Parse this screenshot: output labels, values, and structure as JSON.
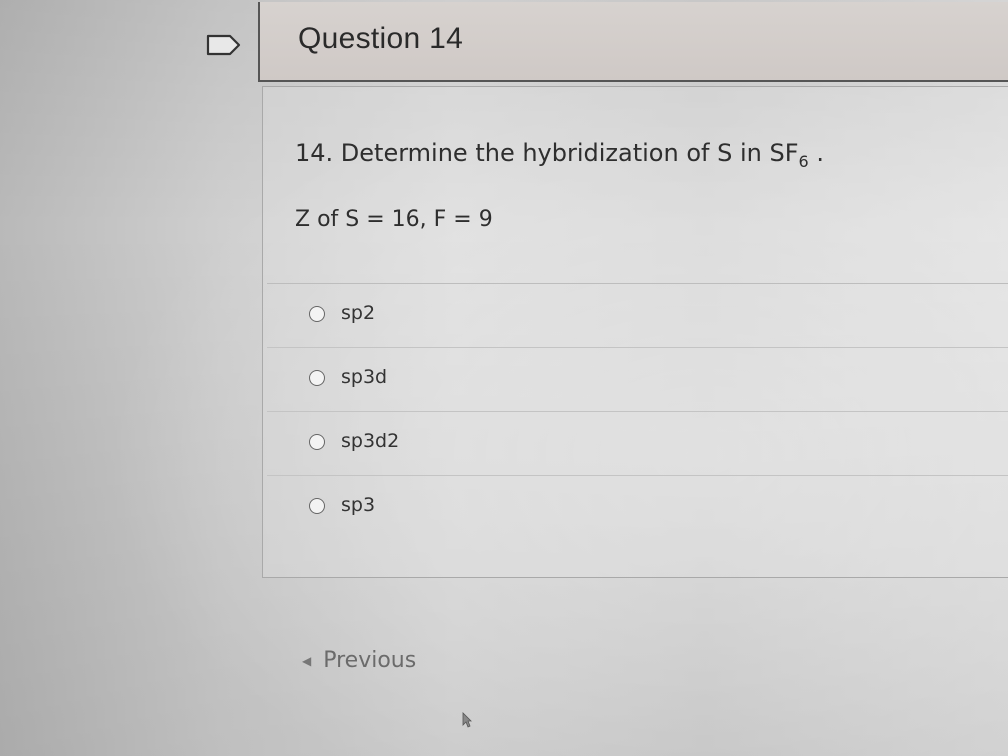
{
  "question": {
    "title": "Question 14",
    "prompt_text": "14. Determine the hybridization of S in SF",
    "prompt_subscript": "6",
    "prompt_suffix": " .",
    "given": "Z of S = 16, F = 9"
  },
  "answers": [
    {
      "label": "sp2"
    },
    {
      "label": "sp3d"
    },
    {
      "label": "sp3d2"
    },
    {
      "label": "sp3"
    }
  ],
  "navigation": {
    "previous_label": "Previous"
  },
  "icons": {
    "flag": "flag-icon",
    "previous": "chevron-left-icon",
    "cursor": "mouse-cursor-icon"
  }
}
